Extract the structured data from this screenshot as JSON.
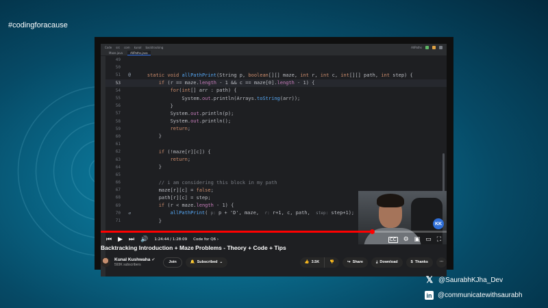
{
  "hashtag": "#codingforacause",
  "ide": {
    "menu": [
      "Code",
      "src",
      "com",
      "kunal",
      "backtracking"
    ],
    "run_config": "AllPaths",
    "tabs": [
      "Maze.java",
      "AllPaths.java"
    ],
    "lines": [
      {
        "n": "49",
        "t": ""
      },
      {
        "n": "50",
        "t": ""
      },
      {
        "n": "51",
        "t": "    static void allPathPrint(String p, boolean[][] maze, int r, int c, int[][] path, int step) {",
        "gutter": "@"
      },
      {
        "n": "53",
        "t": "        if (r == maze.length - 1 && c == maze[0].length - 1) {",
        "active": true
      },
      {
        "n": "54",
        "t": "            for(int[] arr : path) {"
      },
      {
        "n": "55",
        "t": "                System.out.println(Arrays.toString(arr));"
      },
      {
        "n": "56",
        "t": "            }"
      },
      {
        "n": "57",
        "t": "            System.out.println(p);"
      },
      {
        "n": "58",
        "t": "            System.out.println();"
      },
      {
        "n": "59",
        "t": "            return;"
      },
      {
        "n": "60",
        "t": "        }"
      },
      {
        "n": "61",
        "t": ""
      },
      {
        "n": "62",
        "t": "        if (!maze[r][c]) {"
      },
      {
        "n": "63",
        "t": "            return;"
      },
      {
        "n": "64",
        "t": "        }"
      },
      {
        "n": "65",
        "t": ""
      },
      {
        "n": "66",
        "t": "        // i am considering this block in my path"
      },
      {
        "n": "67",
        "t": "        maze[r][c] = false;"
      },
      {
        "n": "68",
        "t": "        path[r][c] = step;"
      },
      {
        "n": "69",
        "t": "        if (r < maze.length - 1) {"
      },
      {
        "n": "70",
        "t": "            allPathPrint( p: p + 'D', maze,  r: r+1, c, path,  step: step+1);",
        "gutter": "↺"
      },
      {
        "n": "71",
        "t": "        }"
      }
    ]
  },
  "badge": "KK",
  "player": {
    "progress_fraction": 0.785,
    "time": "1:24:44 / 1:28:09",
    "chapter": "Code for Q6 ›"
  },
  "video": {
    "title": "Backtracking Introduction + Maze Problems - Theory + Code + Tips",
    "channel": "Kunal Kushwaha",
    "subscribers": "593K subscribers",
    "join_label": "Join",
    "subscribed_label": "Subscribed",
    "likes": "3.5K",
    "share_label": "Share",
    "download_label": "Download",
    "thanks_label": "Thanks"
  },
  "social": {
    "twitter": "@SaurabhKJha_Dev",
    "linkedin": "@communicatewithsaurabh"
  },
  "icons": {
    "play": "play-icon",
    "prev": "previous-icon",
    "next": "next-icon",
    "volume": "volume-icon",
    "captions": "captions-icon",
    "settings": "gear-icon",
    "miniplayer": "miniplayer-icon",
    "theater": "theater-icon",
    "fullscreen": "fullscreen-icon"
  },
  "colors": {
    "accent": "#ff0000",
    "ide_bg": "#1e1f22",
    "keyword": "#cf8e6d",
    "method": "#56a8f5",
    "field": "#c77dbb"
  }
}
